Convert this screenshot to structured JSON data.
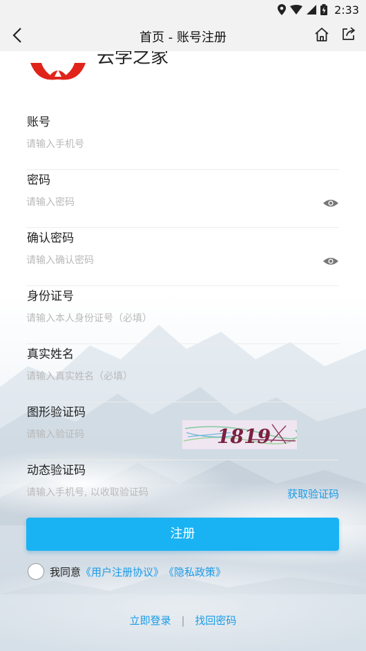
{
  "status_bar": {
    "time": "2:33"
  },
  "nav": {
    "title": "首页 - 账号注册"
  },
  "logo": {
    "text": "云学之家"
  },
  "fields": {
    "account": {
      "label": "账号",
      "placeholder": "请输入手机号"
    },
    "password": {
      "label": "密码",
      "placeholder": "请输入密码"
    },
    "confirm_password": {
      "label": "确认密码",
      "placeholder": "请输入确认密码"
    },
    "id_number": {
      "label": "身份证号",
      "placeholder": "请输入本人身份证号（必填）"
    },
    "real_name": {
      "label": "真实姓名",
      "placeholder": "请输入真实姓名（必填）"
    },
    "captcha": {
      "label": "图形验证码",
      "placeholder": "请输入验证码",
      "image_text": "1819"
    },
    "sms_code": {
      "label": "动态验证码",
      "placeholder": "请输入手机号, 以收取验证码",
      "action": "获取验证码"
    }
  },
  "register_button": "注册",
  "agreement": {
    "prefix": "我同意",
    "user_agreement": "《用户注册协议》",
    "privacy_policy": "《隐私政策》"
  },
  "links": {
    "login": "立即登录",
    "separator": "|",
    "recover": "找回密码"
  },
  "colors": {
    "accent": "#19b3f3",
    "link": "#1a9be8",
    "logo_red": "#e0241a"
  }
}
